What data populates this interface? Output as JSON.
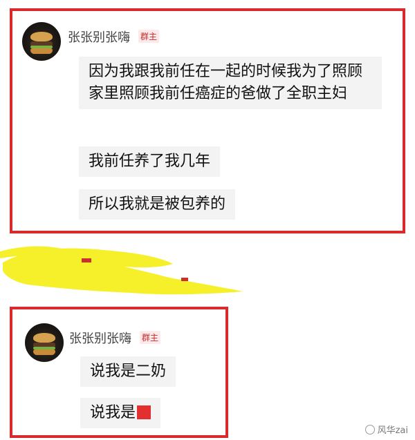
{
  "comments": [
    {
      "username": "张张别张嗨",
      "badge": "群主",
      "messages": [
        "因为我跟我前任在一起的时候我为了照顾家里照顾我前任癌症的爸做了全职主妇",
        "我前任养了我几年",
        "所以我就是被包养的"
      ]
    },
    {
      "username": "张张别张嗨",
      "badge": "群主",
      "messages": [
        "说我是二奶",
        "说我是"
      ]
    }
  ],
  "watermark": "风华zai",
  "colors": {
    "highlight_border": "#d92b2b",
    "bubble": "#f3f3f3",
    "scribble": "#f6f02a"
  }
}
